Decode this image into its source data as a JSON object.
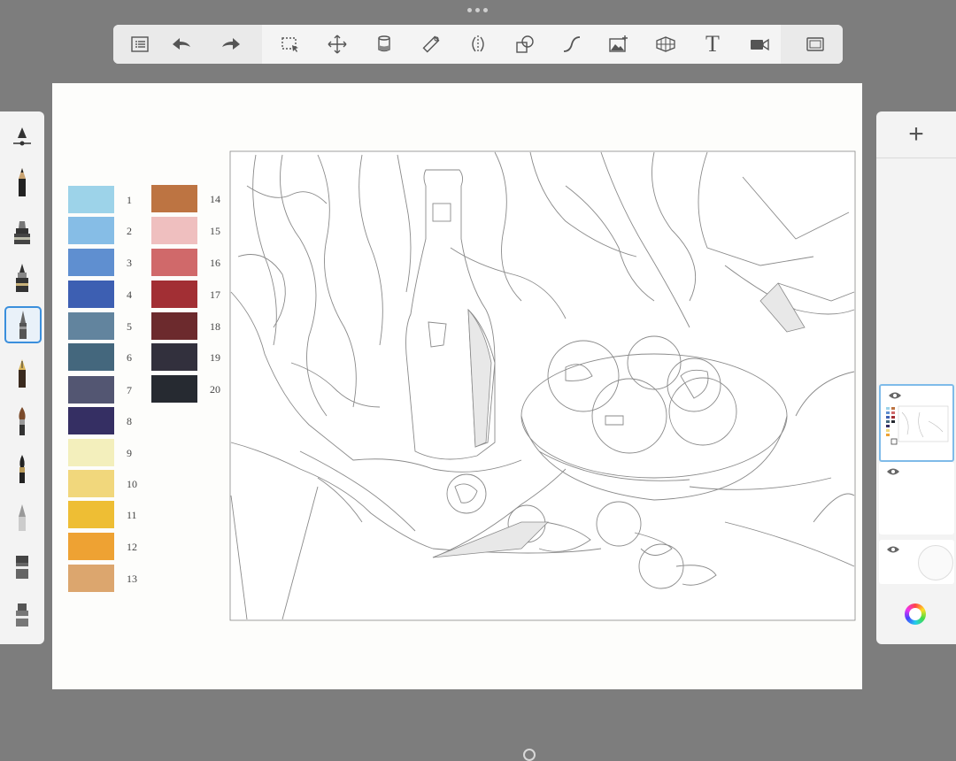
{
  "toolbar": {
    "buttons": [
      {
        "name": "layers-list-icon"
      },
      {
        "name": "undo-icon"
      },
      {
        "name": "redo-icon"
      },
      {
        "name": "selection-icon"
      },
      {
        "name": "transform-icon"
      },
      {
        "name": "fill-bucket-icon"
      },
      {
        "name": "ruler-icon"
      },
      {
        "name": "symmetry-icon"
      },
      {
        "name": "shape-icon"
      },
      {
        "name": "curve-icon"
      },
      {
        "name": "add-image-icon"
      },
      {
        "name": "perspective-grid-icon"
      },
      {
        "name": "text-icon"
      },
      {
        "name": "time-lapse-icon"
      },
      {
        "name": "fullscreen-icon"
      }
    ],
    "text_glyph": "T"
  },
  "palette": [
    {
      "number": "1",
      "color": "#9dd3e9"
    },
    {
      "number": "2",
      "color": "#86bde6"
    },
    {
      "number": "3",
      "color": "#5f8fd0"
    },
    {
      "number": "4",
      "color": "#3d5fb2"
    },
    {
      "number": "5",
      "color": "#62849e"
    },
    {
      "number": "6",
      "color": "#44677d"
    },
    {
      "number": "7",
      "color": "#535672"
    },
    {
      "number": "8",
      "color": "#352f63"
    },
    {
      "number": "9",
      "color": "#f3efbc"
    },
    {
      "number": "10",
      "color": "#f1d77c"
    },
    {
      "number": "11",
      "color": "#eebe34"
    },
    {
      "number": "12",
      "color": "#eea233"
    },
    {
      "number": "13",
      "color": "#dca66e"
    },
    {
      "number": "14",
      "color": "#bd7442"
    },
    {
      "number": "15",
      "color": "#efbfbf"
    },
    {
      "number": "16",
      "color": "#d0696a"
    },
    {
      "number": "17",
      "color": "#a22f34"
    },
    {
      "number": "18",
      "color": "#6c2a2d"
    },
    {
      "number": "19",
      "color": "#32303d"
    },
    {
      "number": "20",
      "color": "#262a31"
    }
  ],
  "brushes": [
    {
      "name": "opacity-slider-icon"
    },
    {
      "name": "pencil-brush-icon"
    },
    {
      "name": "marker-brush-icon"
    },
    {
      "name": "ink-brush-icon"
    },
    {
      "name": "technical-pen-brush-icon",
      "selected": true
    },
    {
      "name": "fountain-pen-brush-icon"
    },
    {
      "name": "paint-brush-icon"
    },
    {
      "name": "fine-brush-icon"
    },
    {
      "name": "airbrush-icon"
    },
    {
      "name": "eraser-icon"
    },
    {
      "name": "smudge-icon"
    }
  ],
  "layers": {
    "add_label": "+",
    "items": [
      {
        "name": "layer-1",
        "active": true
      },
      {
        "name": "layer-2",
        "active": false
      },
      {
        "name": "background-layer",
        "active": false
      }
    ]
  },
  "accent_color": "#3b8fdc"
}
